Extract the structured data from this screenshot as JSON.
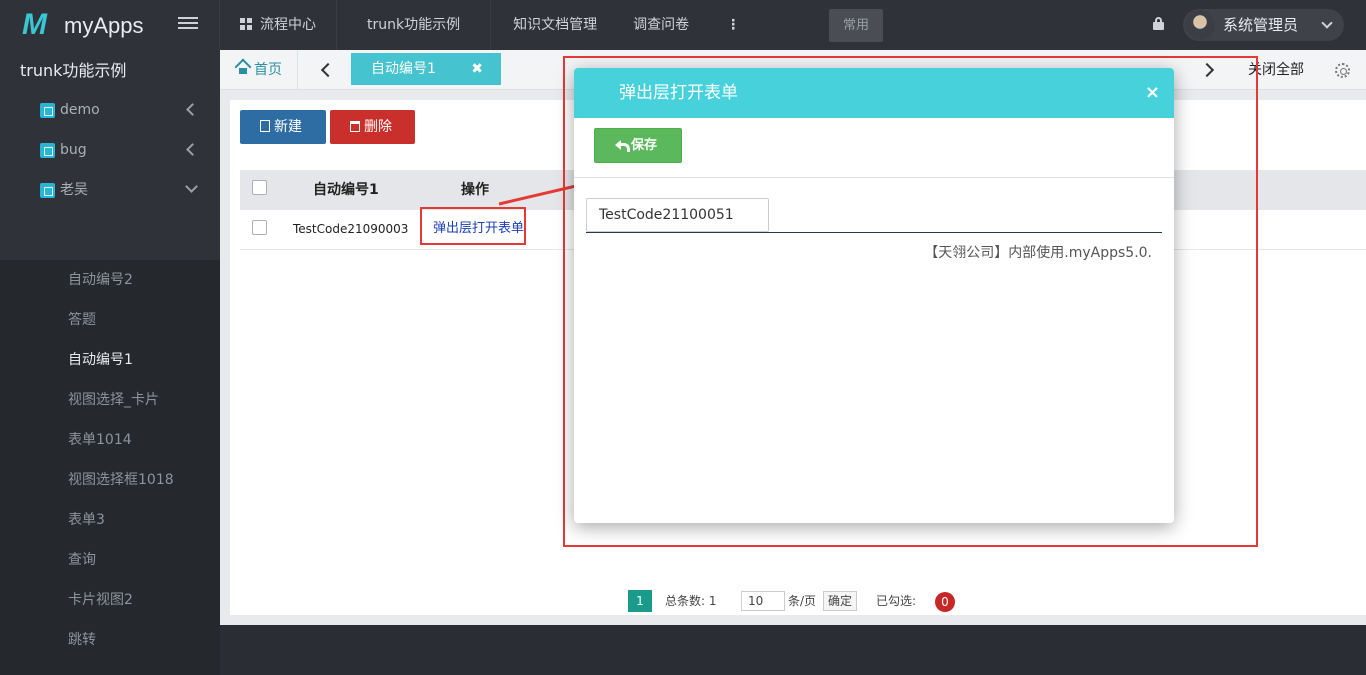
{
  "app": {
    "logo_mark": "M",
    "name": "myApps"
  },
  "topnav": {
    "items": [
      "流程中心",
      "trunk功能示例",
      "知识文档管理",
      "调查问卷"
    ],
    "more": "⋮",
    "common_label": "常用",
    "user_name": "系统管理员"
  },
  "sidebar": {
    "title": "trunk功能示例",
    "groups": [
      "demo",
      "bug",
      "老吴"
    ],
    "subitems": [
      "自动编号2",
      "答题",
      "自动编号1",
      "视图选择_卡片",
      "表单1014",
      "视图选择框1018",
      "表单3",
      "查询",
      "卡片视图2",
      "跳转"
    ],
    "active_subitem": "自动编号1"
  },
  "tabs": {
    "home": "首页",
    "active": "自动编号1",
    "close_all": "关闭全部"
  },
  "toolbar": {
    "new_label": "新建",
    "delete_label": "删除"
  },
  "table": {
    "headers": [
      "自动编号1",
      "操作"
    ],
    "rows": [
      {
        "code": "TestCode21090003",
        "action": "弹出层打开表单"
      }
    ]
  },
  "pager": {
    "current_page": "1",
    "total_label": "总条数: 1",
    "page_size": "10",
    "per_page_label": "条/页",
    "confirm_label": "确定",
    "selected_label": "已勾选:",
    "selected_count": "0"
  },
  "modal": {
    "title": "弹出层打开表单",
    "close": "×",
    "save_label": "保存",
    "field_value": "TestCode21100051",
    "footer": "【天翎公司】内部使用.myApps5.0."
  },
  "colors": {
    "accent": "#47d1db",
    "sidebar_bg": "#2f3238",
    "primary_button": "#2e6da4",
    "danger_button": "#c9302c",
    "save_button": "#5cb85c",
    "annotation": "#e53935"
  }
}
